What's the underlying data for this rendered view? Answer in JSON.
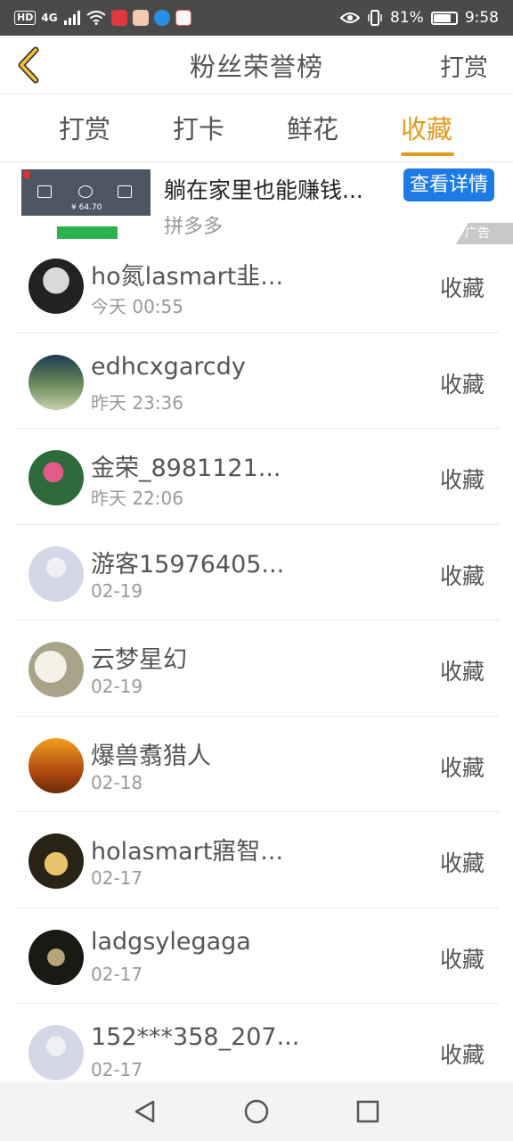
{
  "status_bar": {
    "tags": [
      "HD",
      "4G"
    ],
    "battery_text": "81%",
    "battery_level": 0.81,
    "time": "9:58"
  },
  "header": {
    "title": "粉丝荣誉榜",
    "action": "打赏"
  },
  "tabs": [
    "打赏",
    "打卡",
    "鲜花",
    "收藏"
  ],
  "active_tab": "收藏",
  "ad": {
    "title": "躺在家里也能赚钱...",
    "source": "拼多多",
    "button": "查看详情",
    "badge": "广告",
    "thumb_amount": "¥ 64.70"
  },
  "list": [
    {
      "name": "ho氮lasmart韭...",
      "time": "今天 00:55",
      "action": "收藏",
      "avatar": "photo-dark"
    },
    {
      "name": "edhcxgarcdy",
      "time": "昨天 23:36",
      "action": "收藏",
      "avatar": "photo-flowers-vase"
    },
    {
      "name": "金荣_8981121...",
      "time": "昨天 22:06",
      "action": "收藏",
      "avatar": "photo-lotus"
    },
    {
      "name": "游客15976405...",
      "time": "02-19",
      "action": "收藏",
      "avatar": "default-avatar"
    },
    {
      "name": "云梦星幻",
      "time": "02-19",
      "action": "收藏",
      "avatar": "photo-white-flowers"
    },
    {
      "name": "爆兽翥猎人",
      "time": "02-18",
      "action": "收藏",
      "avatar": "photo-autumn"
    },
    {
      "name": "holasmart寤智...",
      "time": "02-17",
      "action": "收藏",
      "avatar": "photo-food"
    },
    {
      "name": "ladgsylegaga",
      "time": "02-17",
      "action": "收藏",
      "avatar": "photo-dark-flower"
    },
    {
      "name": "152***358_207...",
      "time": "02-17",
      "action": "收藏",
      "avatar": "default-avatar"
    }
  ],
  "colors": {
    "accent": "#e39a1f",
    "ad_button": "#1e7be5",
    "status_bar": "#4a4a4a"
  }
}
